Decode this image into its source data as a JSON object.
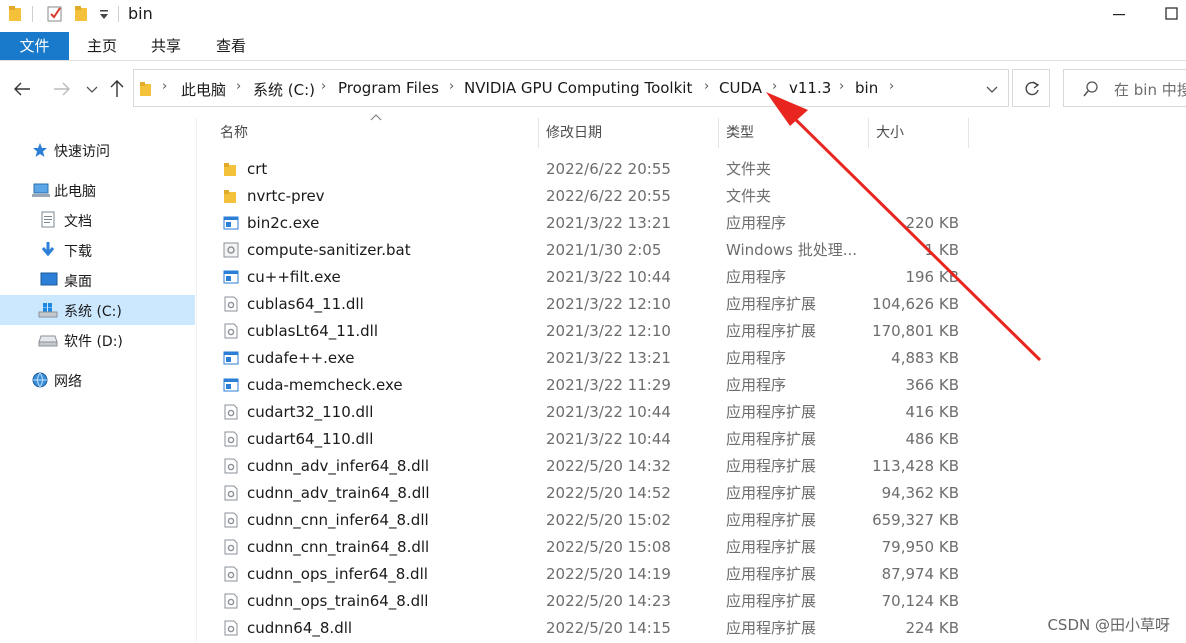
{
  "window": {
    "title": "bin",
    "minimize_icon": "minimize-icon",
    "maximize_icon": "maximize-icon"
  },
  "ribbon": {
    "tabs": [
      {
        "label": "文件",
        "active": true
      },
      {
        "label": "主页",
        "active": false
      },
      {
        "label": "共享",
        "active": false
      },
      {
        "label": "查看",
        "active": false
      }
    ]
  },
  "address": {
    "crumbs": [
      "此电脑",
      "系统 (C:)",
      "Program Files",
      "NVIDIA GPU Computing Toolkit",
      "CUDA",
      "v11.3",
      "bin"
    ],
    "search_placeholder": "在 bin 中搜"
  },
  "nav": {
    "items": [
      {
        "label": "快速访问",
        "icon": "star-icon"
      },
      {
        "label": "此电脑",
        "icon": "computer-icon"
      },
      {
        "label": "文档",
        "icon": "document-icon"
      },
      {
        "label": "下载",
        "icon": "download-icon"
      },
      {
        "label": "桌面",
        "icon": "desktop-icon"
      },
      {
        "label": "系统 (C:)",
        "icon": "windows-drive-icon",
        "selected": true
      },
      {
        "label": "软件 (D:)",
        "icon": "drive-icon"
      },
      {
        "label": "网络",
        "icon": "network-icon"
      }
    ]
  },
  "columns": {
    "name": "名称",
    "date": "修改日期",
    "type": "类型",
    "size": "大小"
  },
  "files": [
    {
      "name": "crt",
      "date": "2022/6/22 20:55",
      "type": "文件夹",
      "size": "",
      "kind": "folder"
    },
    {
      "name": "nvrtc-prev",
      "date": "2022/6/22 20:55",
      "type": "文件夹",
      "size": "",
      "kind": "folder"
    },
    {
      "name": "bin2c.exe",
      "date": "2021/3/22 13:21",
      "type": "应用程序",
      "size": "220 KB",
      "kind": "exe"
    },
    {
      "name": "compute-sanitizer.bat",
      "date": "2021/1/30 2:05",
      "type": "Windows 批处理...",
      "size": "1 KB",
      "kind": "bat"
    },
    {
      "name": "cu++filt.exe",
      "date": "2021/3/22 10:44",
      "type": "应用程序",
      "size": "196 KB",
      "kind": "exe"
    },
    {
      "name": "cublas64_11.dll",
      "date": "2021/3/22 12:10",
      "type": "应用程序扩展",
      "size": "104,626 KB",
      "kind": "dll"
    },
    {
      "name": "cublasLt64_11.dll",
      "date": "2021/3/22 12:10",
      "type": "应用程序扩展",
      "size": "170,801 KB",
      "kind": "dll"
    },
    {
      "name": "cudafe++.exe",
      "date": "2021/3/22 13:21",
      "type": "应用程序",
      "size": "4,883 KB",
      "kind": "exe"
    },
    {
      "name": "cuda-memcheck.exe",
      "date": "2021/3/22 11:29",
      "type": "应用程序",
      "size": "366 KB",
      "kind": "exe"
    },
    {
      "name": "cudart32_110.dll",
      "date": "2021/3/22 10:44",
      "type": "应用程序扩展",
      "size": "416 KB",
      "kind": "dll"
    },
    {
      "name": "cudart64_110.dll",
      "date": "2021/3/22 10:44",
      "type": "应用程序扩展",
      "size": "486 KB",
      "kind": "dll"
    },
    {
      "name": "cudnn_adv_infer64_8.dll",
      "date": "2022/5/20 14:32",
      "type": "应用程序扩展",
      "size": "113,428 KB",
      "kind": "dll"
    },
    {
      "name": "cudnn_adv_train64_8.dll",
      "date": "2022/5/20 14:52",
      "type": "应用程序扩展",
      "size": "94,362 KB",
      "kind": "dll"
    },
    {
      "name": "cudnn_cnn_infer64_8.dll",
      "date": "2022/5/20 15:02",
      "type": "应用程序扩展",
      "size": "659,327 KB",
      "kind": "dll"
    },
    {
      "name": "cudnn_cnn_train64_8.dll",
      "date": "2022/5/20 15:08",
      "type": "应用程序扩展",
      "size": "79,950 KB",
      "kind": "dll"
    },
    {
      "name": "cudnn_ops_infer64_8.dll",
      "date": "2022/5/20 14:19",
      "type": "应用程序扩展",
      "size": "87,974 KB",
      "kind": "dll"
    },
    {
      "name": "cudnn_ops_train64_8.dll",
      "date": "2022/5/20 14:23",
      "type": "应用程序扩展",
      "size": "70,124 KB",
      "kind": "dll"
    },
    {
      "name": "cudnn64_8.dll",
      "date": "2022/5/20 14:15",
      "type": "应用程序扩展",
      "size": "224 KB",
      "kind": "dll"
    }
  ],
  "watermark": "CSDN @田小草呀",
  "colors": {
    "accent": "#1979ca",
    "annotation_arrow": "#e8261f",
    "selected_nav": "#cce8ff",
    "folder": "#f3c13a"
  }
}
